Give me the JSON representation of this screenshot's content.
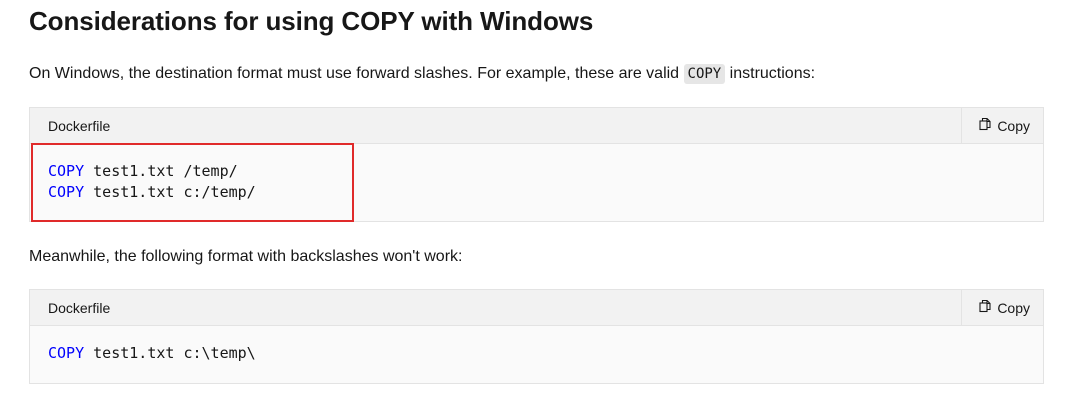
{
  "heading": "Considerations for using COPY with Windows",
  "para1": {
    "before": "On Windows, the destination format must use forward slashes. For example, these are valid ",
    "code": "COPY",
    "after": " instructions:"
  },
  "para2": "Meanwhile, the following format with backslashes won't work:",
  "block1": {
    "lang": "Dockerfile",
    "copy_label": "Copy",
    "lines": [
      {
        "kw": "COPY",
        "rest": " test1.txt /temp/"
      },
      {
        "kw": "COPY",
        "rest": " test1.txt c:/temp/"
      }
    ]
  },
  "block2": {
    "lang": "Dockerfile",
    "copy_label": "Copy",
    "lines": [
      {
        "kw": "COPY",
        "rest": " test1.txt c:\\temp\\"
      }
    ]
  },
  "colors": {
    "keyword": "#0101fd",
    "highlight": "#e02a2a"
  }
}
